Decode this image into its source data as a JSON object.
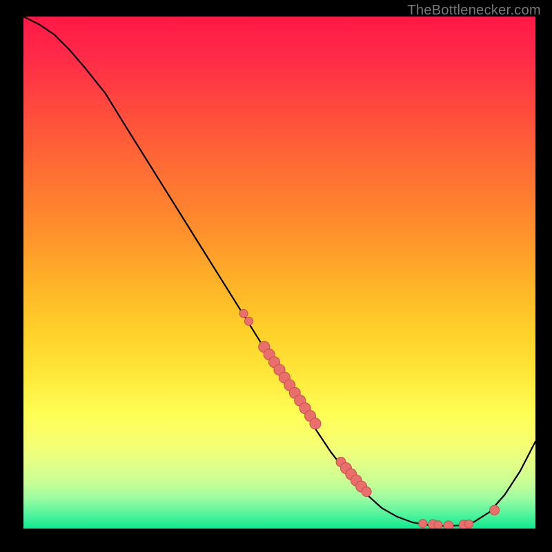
{
  "watermark": "TheBottlenecker.com",
  "colors": {
    "curve": "#000000",
    "point_fill": "#e86f6b",
    "point_stroke": "#c94f49"
  },
  "chart_data": {
    "type": "line",
    "title": "",
    "xlabel": "",
    "ylabel": "",
    "xlim": [
      0,
      100
    ],
    "ylim": [
      0,
      100
    ],
    "series": [
      {
        "name": "curve",
        "x": [
          0,
          3,
          6,
          9,
          12,
          16,
          20,
          25,
          30,
          35,
          40,
          45,
          50,
          55,
          60,
          65,
          70,
          73,
          76,
          79,
          82,
          85,
          88,
          91,
          94,
          97,
          100
        ],
        "y": [
          100,
          98.5,
          96.5,
          93.5,
          90,
          85,
          78.5,
          70.5,
          62.5,
          54.5,
          46.5,
          38.5,
          30.5,
          22.5,
          15,
          8.5,
          4,
          2.3,
          1.2,
          0.7,
          0.5,
          0.6,
          1.3,
          3.2,
          6.6,
          11.2,
          17
        ]
      }
    ],
    "points": {
      "name": "highlighted-points",
      "x": [
        43,
        44,
        47,
        48,
        49,
        50,
        51,
        52,
        53,
        54,
        55,
        56,
        57,
        62,
        63,
        64,
        65,
        66,
        67,
        78,
        80,
        81,
        83,
        86,
        87,
        92
      ],
      "y": [
        42,
        40.5,
        35.5,
        34,
        32.5,
        31,
        29.5,
        28,
        26.5,
        25,
        23.5,
        22,
        20.5,
        13,
        11.8,
        10.6,
        9.4,
        8.2,
        7.2,
        1.0,
        0.8,
        0.7,
        0.55,
        0.7,
        0.9,
        3.6
      ],
      "r": [
        6,
        6,
        8,
        8,
        8,
        8,
        8,
        8,
        8,
        8,
        8,
        8,
        8,
        7,
        8,
        8,
        8,
        8,
        7,
        6,
        7,
        6,
        7,
        7,
        6,
        7
      ]
    }
  }
}
